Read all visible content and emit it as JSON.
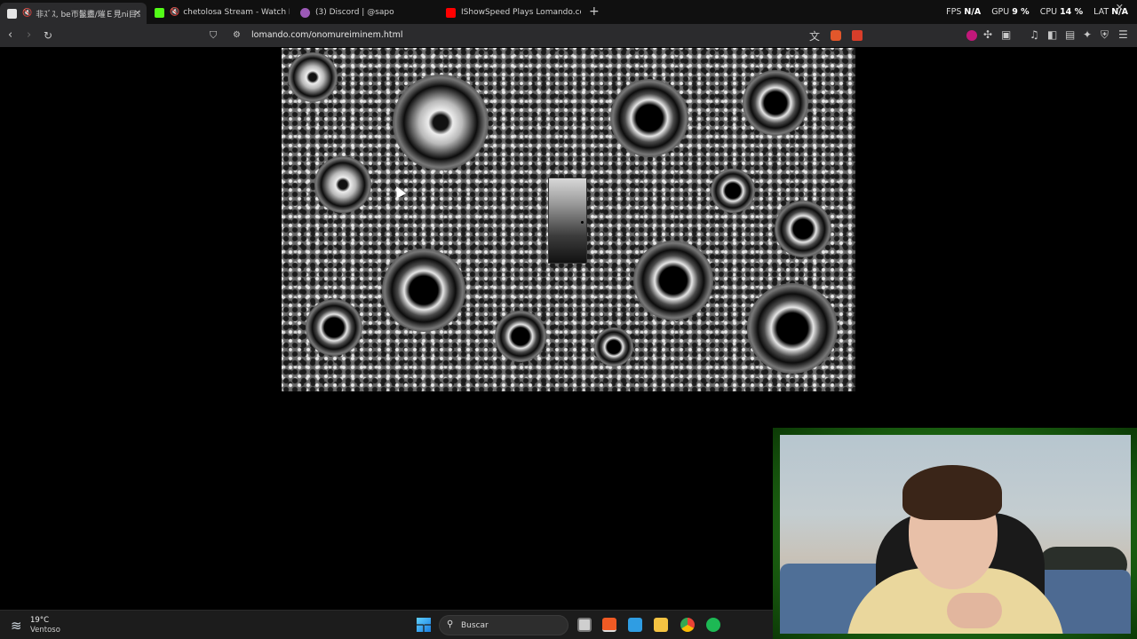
{
  "browser": {
    "tabs": [
      {
        "label": "非ｽﾞｽ, be帀鬣衋/璀Ｅ見ni目ﾆ",
        "active": true,
        "muted": true,
        "favicon_color": "#e5e5e5"
      },
      {
        "label": "chetolosa Stream - Watch Live on",
        "active": false,
        "muted": true,
        "favicon_color": "#53fc18"
      },
      {
        "label": "(3) Discord | @sapo",
        "active": false,
        "muted": false,
        "favicon_color": "#9b59b6"
      },
      {
        "label": "IShowSpeed Plays Lomando.com (PA",
        "active": false,
        "muted": false,
        "favicon_color": "#ff0000"
      }
    ],
    "tab_icons": {
      "new_tab": "plus-icon",
      "close": "close-icon",
      "mute": "speaker-muted-icon"
    },
    "system_monitor": {
      "fps_label": "FPS",
      "fps_value": "N/A",
      "gpu_label": "GPU",
      "gpu_value": "9 %",
      "cpu_label": "CPU",
      "cpu_value": "14 %",
      "lat_label": "LAT",
      "lat_value": "N/A"
    },
    "address_bar": {
      "url": "lomando.com/onomureiminem.html",
      "nav_icons": [
        "back-icon",
        "forward-icon",
        "reload-icon",
        "bookmark-icon",
        "site-info-icon"
      ],
      "toolbar_icons": [
        "translate-icon",
        "brave-shields-icon",
        "brave-rewards-icon",
        "extension-icon",
        "puzzle-icon",
        "screenshot-icon",
        "media-icon",
        "sidebar-icon",
        "wallet-icon",
        "leo-ai-icon",
        "vpn-icon",
        "menu-icon"
      ]
    }
  },
  "game": {
    "scene": "skin texture with eye sockets and a door",
    "eyes": 15,
    "door_present": true
  },
  "taskbar": {
    "weather_temp": "19°C",
    "weather_desc": "Ventoso",
    "search_placeholder": "Buscar",
    "apps": [
      "task-view-icon",
      "brave-browser-icon",
      "store-icon",
      "file-explorer-icon",
      "chrome-icon",
      "spotify-icon"
    ]
  },
  "colors": {
    "tabbar_bg": "#101010",
    "toolbar_bg": "#2b2b2d",
    "page_bg": "#000000",
    "webcam_border": "#2f7d1f",
    "taskbar_bg": "#1c1c1c"
  }
}
